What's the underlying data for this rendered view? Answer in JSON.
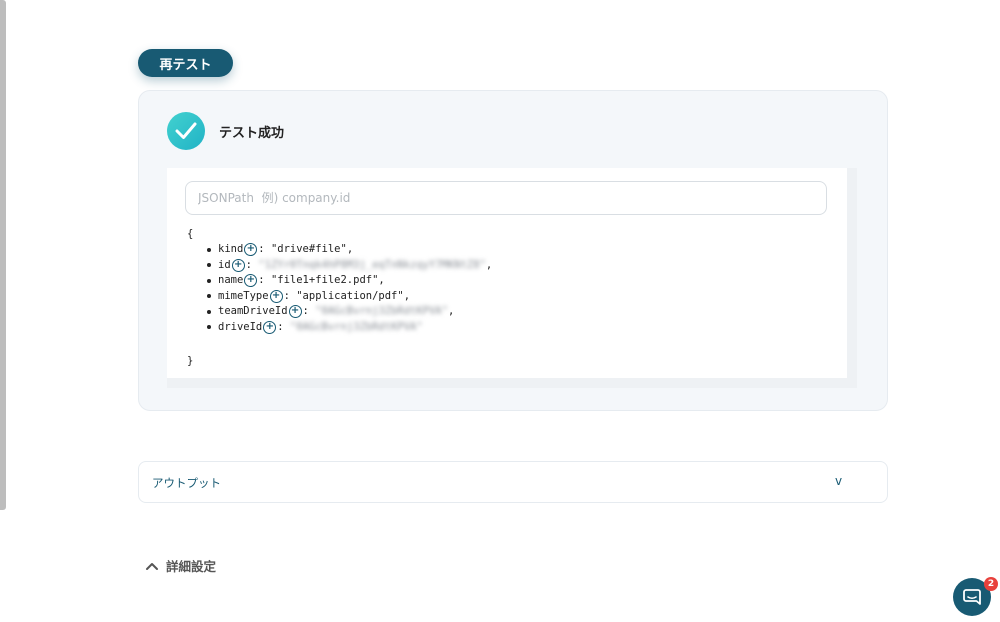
{
  "retest_button": {
    "label": "再テスト"
  },
  "result": {
    "title": "テスト成功",
    "search_placeholder": "JSONPath  例) company.id",
    "open_brace": "{",
    "close_brace": "}",
    "fields": [
      {
        "key": "kind",
        "value": "\"drive#file\"",
        "suffix": ",",
        "blurred": false
      },
      {
        "key": "id",
        "value": "\"1ZYr0Tnqk4hP8M3j_eqTnNkzqyY7MKNtZ8\"",
        "suffix": ",",
        "blurred": true
      },
      {
        "key": "name",
        "value": "\"file1+file2.pdf\"",
        "suffix": ",",
        "blurred": false
      },
      {
        "key": "mimeType",
        "value": "\"application/pdf\"",
        "suffix": ",",
        "blurred": false
      },
      {
        "key": "teamDriveId",
        "value": "\"0AGcBvrnj3ZbRdtKPVA\"",
        "suffix": ",",
        "blurred": true
      },
      {
        "key": "driveId",
        "value": "\"0AGcBvrnj3ZbRdtKPVA\"",
        "suffix": "",
        "blurred": true
      }
    ]
  },
  "output_panel": {
    "label": "アウトプット",
    "chevron": "v"
  },
  "advanced_settings": {
    "label": "詳細設定"
  },
  "chat": {
    "badge_count": "2"
  },
  "colors": {
    "primary": "#185a73",
    "success_start": "#42d1cf",
    "success_end": "#21b3c6",
    "badge": "#e8413c"
  }
}
